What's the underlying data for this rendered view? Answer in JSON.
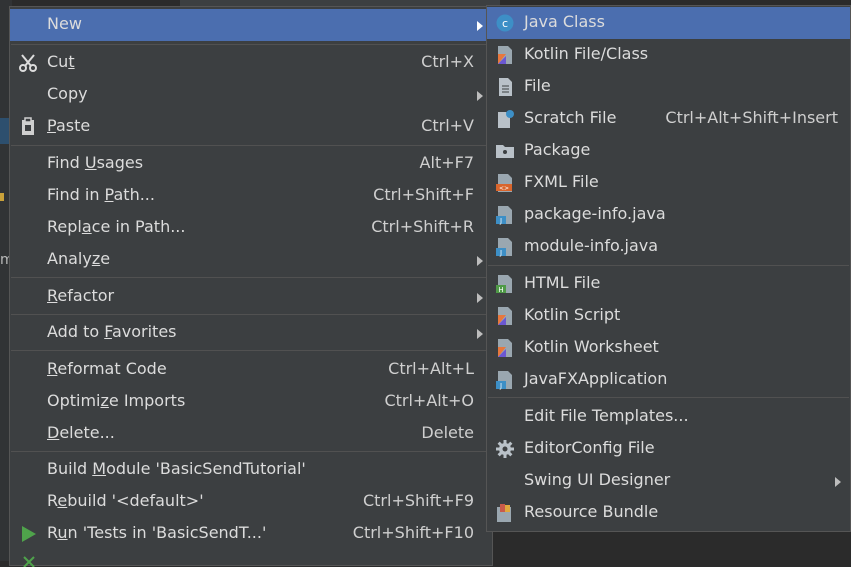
{
  "main_menu": {
    "items": [
      {
        "pre": "",
        "u": "",
        "post": "New",
        "shortcut": "",
        "submenu": true,
        "selected": true
      },
      {
        "pre": "Cu",
        "u": "t",
        "post": "",
        "shortcut": "Ctrl+X",
        "icon": "scissors-icon"
      },
      {
        "pre": "",
        "u": "",
        "post": "Copy",
        "shortcut": "",
        "submenu": true
      },
      {
        "pre": "",
        "u": "P",
        "post": "aste",
        "shortcut": "Ctrl+V",
        "icon": "clipboard-icon"
      },
      {
        "pre": "Find ",
        "u": "U",
        "post": "sages",
        "shortcut": "Alt+F7"
      },
      {
        "pre": "Find in ",
        "u": "P",
        "post": "ath...",
        "shortcut": "Ctrl+Shift+F"
      },
      {
        "pre": "Repl",
        "u": "a",
        "post": "ce in Path...",
        "shortcut": "Ctrl+Shift+R"
      },
      {
        "pre": "Analy",
        "u": "z",
        "post": "e",
        "shortcut": "",
        "submenu": true
      },
      {
        "pre": "",
        "u": "R",
        "post": "efactor",
        "shortcut": "",
        "submenu": true
      },
      {
        "pre": "Add to ",
        "u": "F",
        "post": "avorites",
        "shortcut": "",
        "submenu": true
      },
      {
        "pre": "",
        "u": "R",
        "post": "eformat Code",
        "shortcut": "Ctrl+Alt+L"
      },
      {
        "pre": "Optimi",
        "u": "z",
        "post": "e Imports",
        "shortcut": "Ctrl+Alt+O"
      },
      {
        "pre": "",
        "u": "D",
        "post": "elete...",
        "shortcut": "Delete"
      },
      {
        "pre": "Build ",
        "u": "M",
        "post": "odule 'BasicSendTutorial'",
        "shortcut": ""
      },
      {
        "pre": "R",
        "u": "e",
        "post": "build '<default>'",
        "shortcut": "Ctrl+Shift+F9"
      },
      {
        "pre": "R",
        "u": "u",
        "post": "n 'Tests in 'BasicSendT...'",
        "shortcut": "Ctrl+Shift+F10",
        "icon": "run-icon"
      }
    ]
  },
  "sub_menu": {
    "items": [
      {
        "label": "Java Class",
        "shortcut": "",
        "icon": "java-class-icon",
        "selected": true
      },
      {
        "label": "Kotlin File/Class",
        "shortcut": "",
        "icon": "kotlin-file-icon"
      },
      {
        "label": "File",
        "shortcut": "",
        "icon": "file-icon"
      },
      {
        "label": "Scratch File",
        "shortcut": "Ctrl+Alt+Shift+Insert",
        "icon": "scratch-file-icon"
      },
      {
        "label": "Package",
        "shortcut": "",
        "icon": "package-icon"
      },
      {
        "label": "FXML File",
        "shortcut": "",
        "icon": "fxml-file-icon"
      },
      {
        "label": "package-info.java",
        "shortcut": "",
        "icon": "java-file-icon"
      },
      {
        "label": "module-info.java",
        "shortcut": "",
        "icon": "java-file-icon"
      },
      {
        "label": "HTML File",
        "shortcut": "",
        "icon": "html-file-icon"
      },
      {
        "label": "Kotlin Script",
        "shortcut": "",
        "icon": "kotlin-script-icon"
      },
      {
        "label": "Kotlin Worksheet",
        "shortcut": "",
        "icon": "kotlin-worksheet-icon"
      },
      {
        "label": "JavaFXApplication",
        "shortcut": "",
        "icon": "javafx-icon"
      },
      {
        "label": "Edit File Templates...",
        "shortcut": ""
      },
      {
        "label": "EditorConfig File",
        "shortcut": "",
        "icon": "gear-icon"
      },
      {
        "label": "Swing UI Designer",
        "shortcut": "",
        "submenu": true
      },
      {
        "label": "Resource Bundle",
        "shortcut": "",
        "icon": "resource-bundle-icon"
      }
    ]
  },
  "colors": {
    "menu_bg": "#3c3f41",
    "selection": "#4b6eaf",
    "separator": "#515151",
    "text": "#dcdcdc"
  }
}
